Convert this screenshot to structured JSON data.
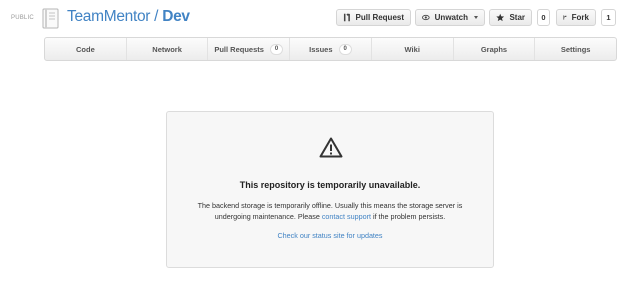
{
  "repo": {
    "visibility": "PUBLIC",
    "owner": "TeamMentor",
    "separator": " / ",
    "name": "Dev"
  },
  "actions": {
    "pull_request_label": "Pull Request",
    "unwatch_label": "Unwatch",
    "star_label": "Star",
    "star_count": "0",
    "fork_label": "Fork",
    "fork_count": "1"
  },
  "tabs": [
    {
      "label": "Code"
    },
    {
      "label": "Network"
    },
    {
      "label": "Pull Requests",
      "count": "0"
    },
    {
      "label": "Issues",
      "count": "0"
    },
    {
      "label": "Wiki"
    },
    {
      "label": "Graphs"
    },
    {
      "label": "Settings"
    }
  ],
  "notice": {
    "title": "This repository is temporarily unavailable.",
    "body_line1": "The backend storage is temporarily offline. Usually this means the storage server is",
    "body_line2_pre": "undergoing maintenance. Please ",
    "contact_link": "contact support",
    "body_line2_post": " if the problem persists.",
    "status_link": "Check our status site for updates"
  },
  "colors": {
    "link": "#4183c4",
    "panel_bg": "#f7f7f7"
  },
  "icons": {
    "repo": "repo-book-icon",
    "pull_request": "pull-request-icon",
    "unwatch": "eye-icon",
    "star": "star-icon",
    "fork": "fork-icon",
    "warning": "warning-triangle-icon"
  }
}
